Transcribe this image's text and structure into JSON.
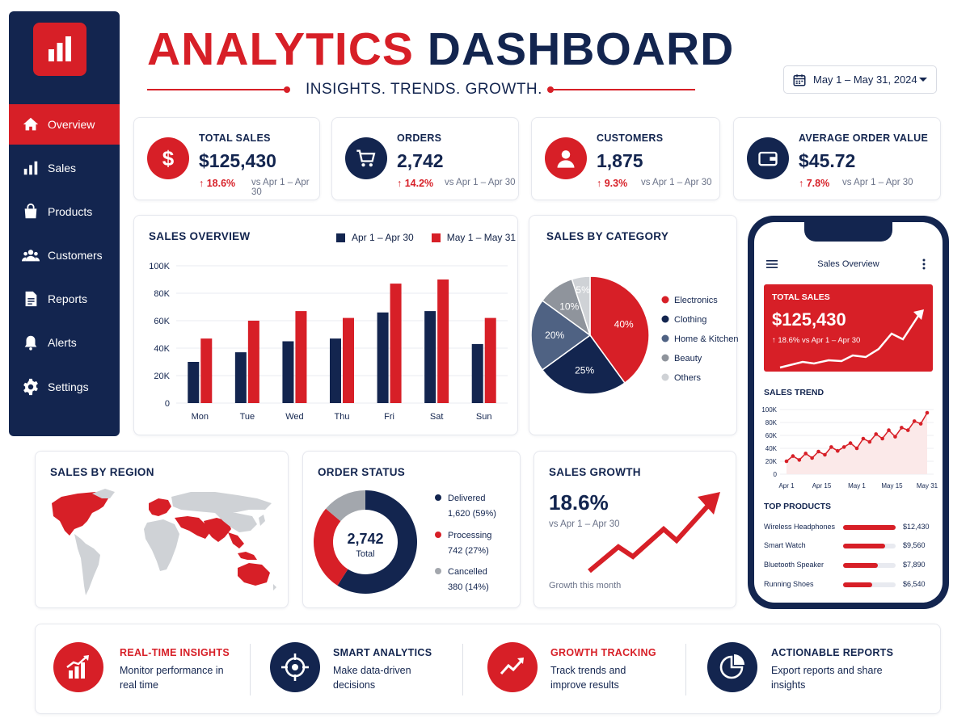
{
  "colors": {
    "navy": "#13254f",
    "red": "#d71f27",
    "slate": "#4f6283",
    "gray": "#8f949c",
    "light_gray": "#cfd2d6"
  },
  "sidebar": {
    "logo_icon": "bar-chart-icon",
    "items": [
      {
        "label": "Overview",
        "icon": "home-icon",
        "active": true
      },
      {
        "label": "Sales",
        "icon": "bar-chart-icon"
      },
      {
        "label": "Products",
        "icon": "shopping-bag-icon"
      },
      {
        "label": "Customers",
        "icon": "users-icon"
      },
      {
        "label": "Reports",
        "icon": "document-icon"
      },
      {
        "label": "Alerts",
        "icon": "bell-icon"
      },
      {
        "label": "Settings",
        "icon": "gear-icon"
      }
    ]
  },
  "header": {
    "title_part1": "ANALYTICS",
    "title_part2": "DASHBOARD",
    "subtitle": "INSIGHTS. TRENDS. GROWTH.",
    "date_range": "May 1 – May 31, 2024"
  },
  "kpis": [
    {
      "label": "TOTAL SALES",
      "value": "$125,430",
      "change": "↑ 18.6%",
      "vs": "vs Apr 1 – Apr 30",
      "icon": "dollar-icon"
    },
    {
      "label": "ORDERS",
      "value": "2,742",
      "change": "↑ 14.2%",
      "vs": "vs Apr 1 – Apr 30",
      "icon": "cart-icon"
    },
    {
      "label": "CUSTOMERS",
      "value": "1,875",
      "change": "↑ 9.3%",
      "vs": "vs Apr 1 – Apr 30",
      "icon": "user-icon"
    },
    {
      "label": "AVERAGE ORDER VALUE",
      "value": "$45.72",
      "change": "↑ 7.8%",
      "vs": "vs Apr 1 – Apr 30",
      "icon": "wallet-icon"
    }
  ],
  "sales_overview": {
    "title": "SALES OVERVIEW",
    "legend": [
      "Apr 1 – Apr 30",
      "May 1 – May 31"
    ],
    "y_ticks": [
      "100K",
      "80K",
      "60K",
      "40K",
      "20K",
      "0"
    ]
  },
  "sales_by_category": {
    "title": "SALES BY CATEGORY",
    "slice_labels": [
      "40%",
      "25%",
      "20%",
      "10%",
      "5%"
    ]
  },
  "sales_by_region": {
    "title": "SALES BY REGION"
  },
  "order_status": {
    "title": "ORDER STATUS",
    "center_value": "2,742",
    "center_label": "Total",
    "items": [
      {
        "label": "Delivered",
        "detail": "1,620 (59%)"
      },
      {
        "label": "Processing",
        "detail": "742 (27%)"
      },
      {
        "label": "Cancelled",
        "detail": "380 (14%)"
      }
    ]
  },
  "sales_growth": {
    "title": "SALES GROWTH",
    "value": "18.6%",
    "vs": "vs Apr 1 – Apr 30",
    "caption": "Growth this month"
  },
  "phone": {
    "header_title": "Sales Overview",
    "total_label": "TOTAL SALES",
    "total_value": "$125,430",
    "total_change": "↑ 18.6% vs Apr 1 – Apr 30",
    "trend_title": "SALES TREND",
    "trend_y_ticks": [
      "100K",
      "80K",
      "60K",
      "40K",
      "20K",
      "0"
    ],
    "trend_x_ticks": [
      "Apr 1",
      "Apr 15",
      "May 1",
      "May 15",
      "May 31"
    ],
    "top_products_title": "TOP PRODUCTS",
    "top_products": [
      {
        "name": "Wireless Headphones",
        "value": "$12,430",
        "fraction": 1.0
      },
      {
        "name": "Smart Watch",
        "value": "$9,560",
        "fraction": 0.8
      },
      {
        "name": "Bluetooth Speaker",
        "value": "$7,890",
        "fraction": 0.66
      },
      {
        "name": "Running Shoes",
        "value": "$6,540",
        "fraction": 0.55
      }
    ]
  },
  "features": [
    {
      "title": "REAL-TIME INSIGHTS",
      "desc": "Monitor performance in real time",
      "icon": "rising-bars-icon",
      "accent": "red"
    },
    {
      "title": "SMART ANALYTICS",
      "desc": "Make data-driven decisions",
      "icon": "target-icon",
      "accent": "navy"
    },
    {
      "title": "GROWTH TRACKING",
      "desc": "Track trends and improve results",
      "icon": "trend-arrow-icon",
      "accent": "red"
    },
    {
      "title": "ACTIONABLE REPORTS",
      "desc": "Export reports and share insights",
      "icon": "pie-chart-icon",
      "accent": "navy"
    }
  ],
  "chart_data": [
    {
      "type": "bar",
      "title": "SALES OVERVIEW",
      "categories": [
        "Mon",
        "Tue",
        "Wed",
        "Thu",
        "Fri",
        "Sat",
        "Sun"
      ],
      "series": [
        {
          "name": "Apr 1 – Apr 30",
          "values": [
            30000,
            37000,
            45000,
            47000,
            66000,
            67000,
            43000
          ]
        },
        {
          "name": "May 1 – May 31",
          "values": [
            47000,
            60000,
            67000,
            62000,
            87000,
            90000,
            62000
          ]
        }
      ],
      "ylim": [
        0,
        100000
      ],
      "y_ticks": [
        "0",
        "20K",
        "40K",
        "60K",
        "80K",
        "100K"
      ],
      "grid": true,
      "legend": "top-right"
    },
    {
      "type": "pie",
      "title": "SALES BY CATEGORY",
      "categories": [
        "Electronics",
        "Clothing",
        "Home & Kitchen",
        "Beauty",
        "Others"
      ],
      "values": [
        40,
        25,
        20,
        10,
        5
      ],
      "legend": "right"
    },
    {
      "type": "pie",
      "title": "ORDER STATUS",
      "categories": [
        "Delivered",
        "Processing",
        "Cancelled"
      ],
      "values": [
        1620,
        742,
        380
      ],
      "legend": "right"
    },
    {
      "type": "line",
      "title": "SALES TREND",
      "x_ticks": [
        "Apr 1",
        "Apr 15",
        "May 1",
        "May 15",
        "May 31"
      ],
      "values": [
        20000,
        28000,
        22000,
        32000,
        25000,
        35000,
        30000,
        42000,
        36000,
        42000,
        48000,
        40000,
        55000,
        50000,
        62000,
        55000,
        68000,
        58000,
        72000,
        68000,
        82000,
        78000,
        95000
      ],
      "ylim": [
        0,
        100000
      ],
      "y_ticks": [
        "0",
        "20K",
        "40K",
        "60K",
        "80K",
        "100K"
      ],
      "grid": true
    }
  ]
}
